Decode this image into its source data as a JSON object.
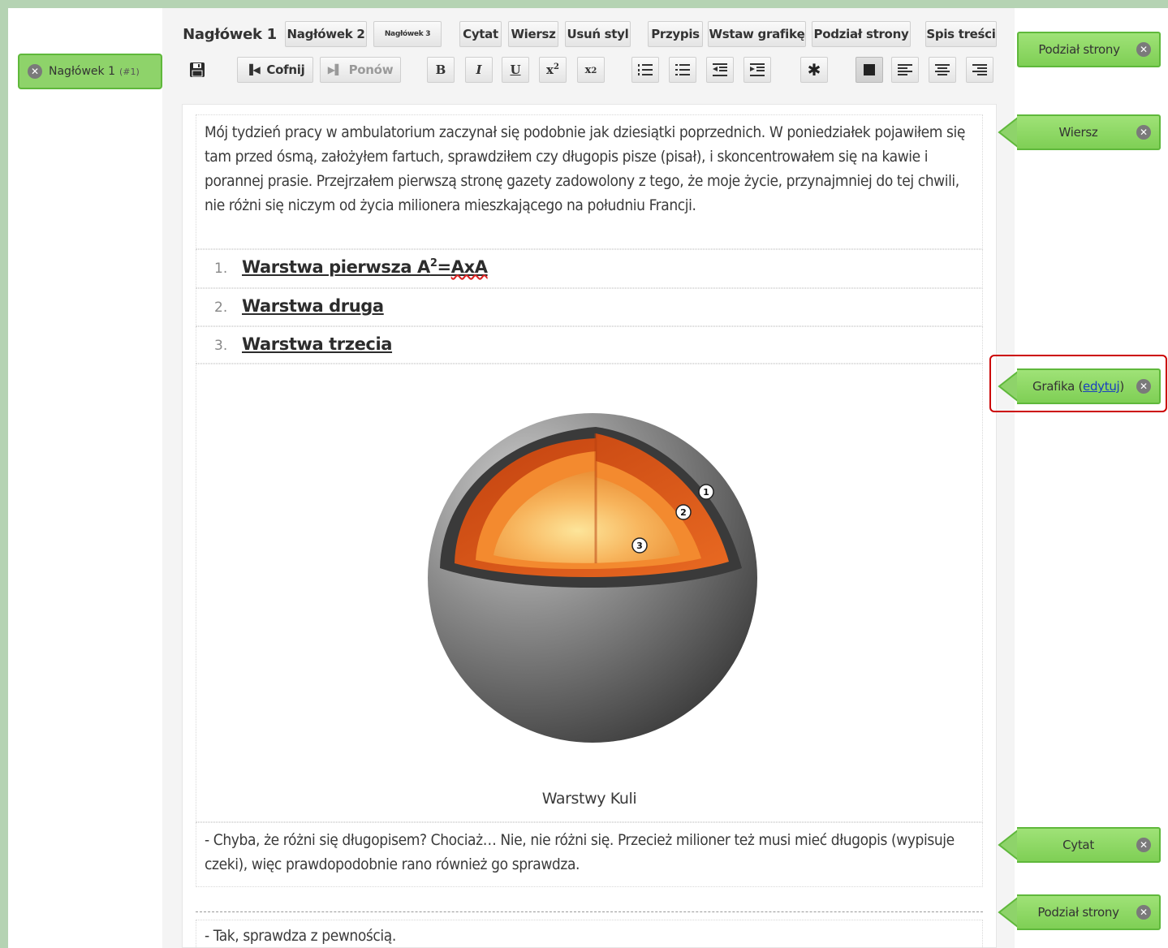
{
  "toolbar": {
    "row1": {
      "heading1": "Nagłówek 1",
      "heading2": "Nagłówek 2",
      "heading3": "Nagłówek 3",
      "quote": "Cytat",
      "line": "Wiersz",
      "remove_style": "Usuń styl",
      "footnote": "Przypis",
      "insert_image": "Wstaw grafikę",
      "page_break": "Podział strony",
      "toc": "Spis treści"
    },
    "row2": {
      "undo": "Cofnij",
      "redo": "Ponów",
      "bold": "B",
      "italic": "I",
      "underline": "U",
      "superscript_base": "x",
      "superscript_exp": "2",
      "subscript_base": "x",
      "subscript_exp": "2"
    }
  },
  "left_panel": {
    "tag_label": "Nagłówek 1",
    "tag_index": "(#1)"
  },
  "document": {
    "paragraph1": "Mój tydzień pracy w ambulatorium zaczynał się podobnie jak dziesiątki poprzednich. W poniedziałek pojawiłem się tam przed ósmą, założyłem fartuch, sprawdziłem czy długopis pisze (pisał), i skoncentrowałem się na kawie i porannej prasie. Przejrzałem pierwszą stronę gazety zadowolony z tego, że moje życie, przynajmniej do tej chwili, nie różni się niczym od życia milionera mieszkającego na południu Francji.",
    "list": [
      {
        "num": "1.",
        "text_a": "Warstwa pierwsza A",
        "sup": "2",
        "text_eq": "=",
        "text_b": "AxA"
      },
      {
        "num": "2.",
        "text": "Warstwa druga"
      },
      {
        "num": "3.",
        "text": "Warstwa trzecia"
      }
    ],
    "image": {
      "caption": "Warstwy Kuli",
      "markers": [
        "1",
        "2",
        "3"
      ]
    },
    "paragraph2": "- Chyba, że różni się długopisem? Chociaż… Nie, nie różni się. Przecież milioner też musi mieć długopis (wypisuje czeki), więc prawdopodobnie rano również go sprawdza.",
    "paragraph3": "- Tak, sprawdza z pewnością."
  },
  "right_tags": {
    "page_break_top": "Podział strony",
    "line": "Wiersz",
    "image": "Grafika",
    "image_edit_open": "(",
    "image_edit_link": "edytuj",
    "image_edit_close": ")",
    "quote": "Cytat",
    "page_break_bottom": "Podział strony",
    "close_glyph": "✕"
  },
  "colors": {
    "background": "#b5d3b3",
    "tag_green": "#8ed36a",
    "tag_border": "#5fb83b",
    "highlight": "#cc0000"
  }
}
